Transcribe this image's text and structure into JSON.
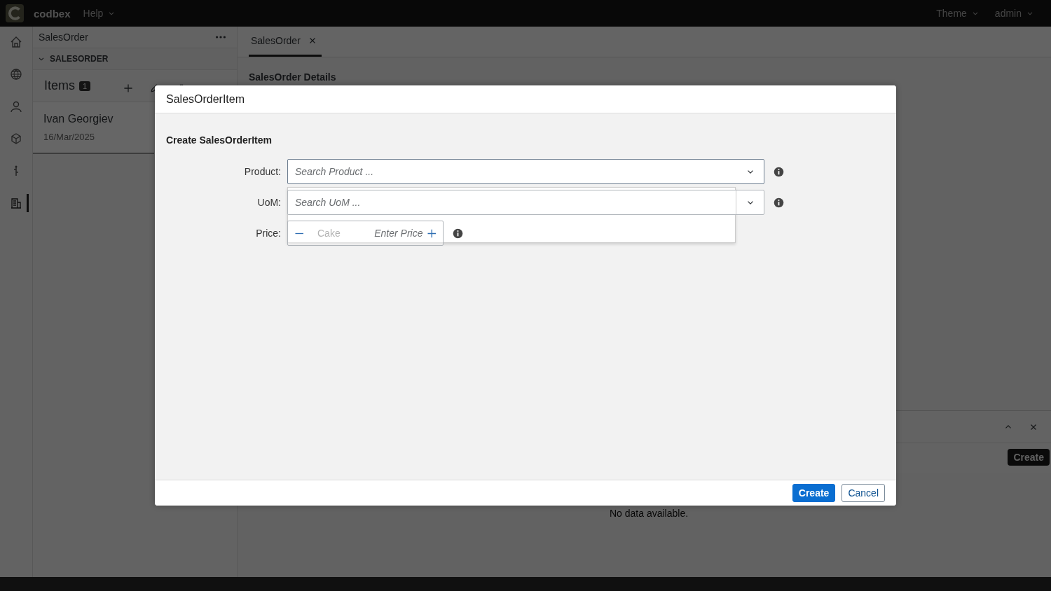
{
  "header": {
    "logo_text": "codbex",
    "menus": [
      {
        "label": "Help"
      }
    ],
    "right_menus": [
      {
        "label": "Theme"
      },
      {
        "label": "admin"
      }
    ]
  },
  "rail": [
    {
      "kind": "home",
      "selected": false
    },
    {
      "kind": "globe",
      "selected": false
    },
    {
      "kind": "user",
      "selected": false
    },
    {
      "kind": "box",
      "selected": false
    },
    {
      "kind": "tree",
      "selected": false
    },
    {
      "kind": "building",
      "selected": true
    }
  ],
  "panel": {
    "title": "SalesOrder",
    "section": "SALESORDER",
    "expanded": true,
    "list_title": "Items",
    "count": "1",
    "items": [
      {
        "title": "Ivan Georgiev",
        "subtitle": "16/Mar/2025",
        "selected": true
      }
    ]
  },
  "tabs": [
    {
      "label": "SalesOrder",
      "selected": true
    }
  ],
  "details_title": "SalesOrder Details",
  "no_data": "No data available.",
  "side_panel": {
    "button": "Create"
  },
  "dialog": {
    "title": "SalesOrderItem",
    "form_title": "Create SalesOrderItem",
    "fields": [
      {
        "label": "Product:",
        "kind": "combo",
        "placeholder": "Search Product ...",
        "focused": true
      },
      {
        "label": "UoM:",
        "kind": "combo",
        "placeholder": "Search UoM ...",
        "focused": false
      },
      {
        "label": "Price:",
        "kind": "stepper",
        "placeholder": "Enter Price",
        "focused": false
      }
    ],
    "suggestions": [
      "Cake"
    ],
    "buttons": [
      {
        "label": "Create",
        "kind": "primary"
      },
      {
        "label": "Cancel",
        "kind": "secondary"
      }
    ]
  }
}
